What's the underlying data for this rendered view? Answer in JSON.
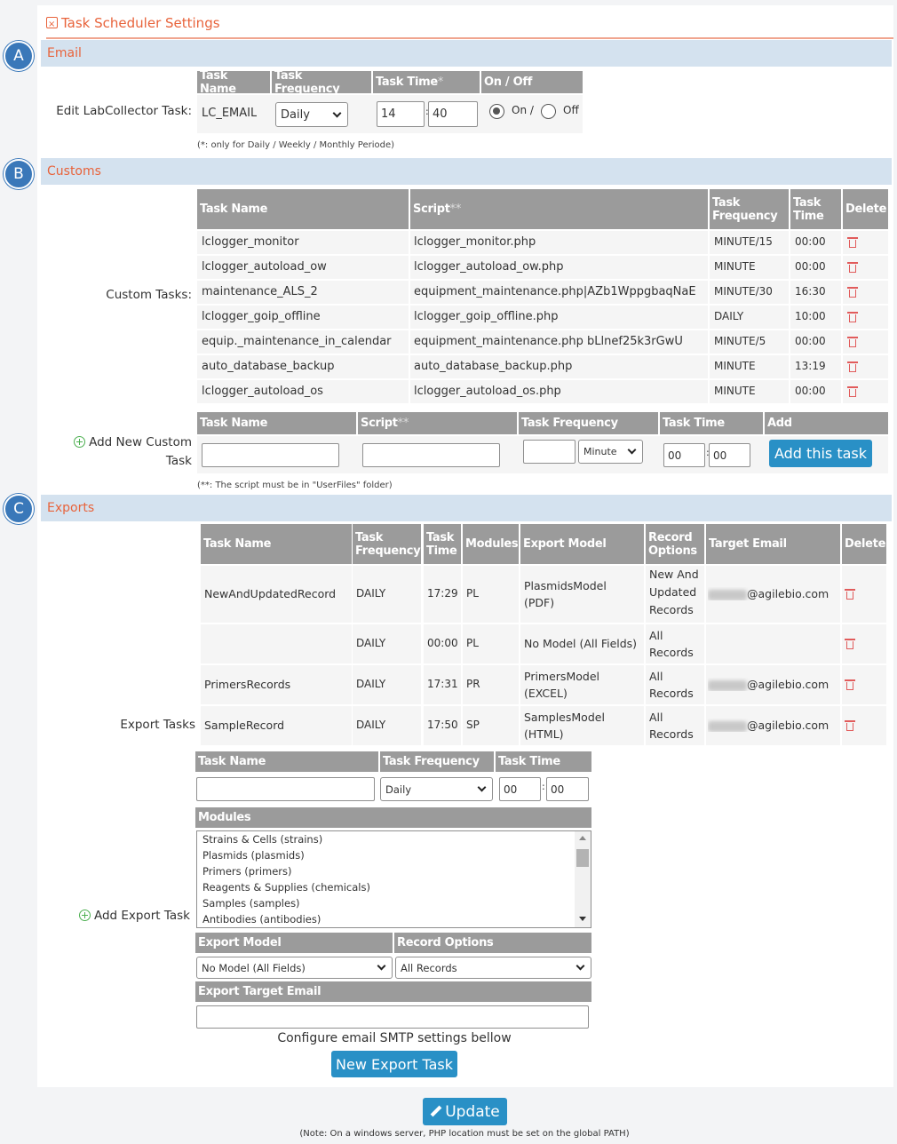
{
  "panel_title": "Task Scheduler Settings",
  "badges": {
    "a": "A",
    "b": "B",
    "c": "C"
  },
  "email": {
    "section": "Email",
    "row_label": "Edit LabCollector Task:",
    "headers": [
      "Task Name",
      "Task Frequency",
      "Task Time",
      "On / Off"
    ],
    "asterisk": "*",
    "task_name": "LC_EMAIL",
    "frequency": "Daily",
    "hour": "14",
    "minute": "40",
    "colon": ":",
    "on_label": "On /",
    "off_label": "Off",
    "note": "(*: only for Daily / Weekly / Monthly Periode)"
  },
  "customs": {
    "section": "Customs",
    "row_label": "Custom Tasks:",
    "headers": [
      "Task Name",
      "Script",
      "Task Frequency",
      "Task Time",
      "Delete"
    ],
    "asterisks": "**",
    "rows": [
      {
        "name": "lclogger_monitor",
        "script": "lclogger_monitor.php",
        "freq": "MINUTE/15",
        "time": "00:00"
      },
      {
        "name": "lclogger_autoload_ow",
        "script": "lclogger_autoload_ow.php",
        "freq": "MINUTE",
        "time": "00:00"
      },
      {
        "name": "maintenance_ALS_2",
        "script": "equipment_maintenance.php|AZb1WppgbaqNaE",
        "freq": "MINUTE/30",
        "time": "16:30"
      },
      {
        "name": "lclogger_goip_offline",
        "script": "lclogger_goip_offline.php",
        "freq": "DAILY",
        "time": "10:00"
      },
      {
        "name": "equip._maintenance_in_calendar",
        "script": "equipment_maintenance.php bLlnef25k3rGwU",
        "freq": "MINUTE/5",
        "time": "00:00"
      },
      {
        "name": "auto_database_backup",
        "script": "auto_database_backup.php",
        "freq": "MINUTE",
        "time": "13:19"
      },
      {
        "name": "lclogger_autoload_os",
        "script": "lclogger_autoload_os.php",
        "freq": "MINUTE",
        "time": "00:00"
      }
    ],
    "add_label_1": "Add New Custom",
    "add_label_2": "Task",
    "add_headers": [
      "Task Name",
      "Script",
      "Task Frequency",
      "Task Time",
      "Add"
    ],
    "add_freq_select": "Minute",
    "add_hour": "00",
    "add_minute": "00",
    "add_button": "Add this task",
    "note": "(**: The script must be in \"UserFiles\" folder)"
  },
  "exports": {
    "section": "Exports",
    "row_label": "Export Tasks",
    "headers": {
      "name": "Task Name",
      "freq1": "Task",
      "freq2": "Frequency",
      "time1": "Task",
      "time2": "Time",
      "modules": "Modules",
      "model": "Export Model",
      "rec1": "Record",
      "rec2": "Options",
      "email": "Target Email",
      "delete": "Delete"
    },
    "rows": [
      {
        "name": "NewAndUpdatedRecord",
        "freq": "DAILY",
        "time": "17:29",
        "module": "PL",
        "model1": "PlasmidsModel",
        "model2": "(PDF)",
        "rec1": "New And",
        "rec2": "Updated",
        "rec3": "Records",
        "email": "@agilebio.com"
      },
      {
        "name": "",
        "freq": "DAILY",
        "time": "00:00",
        "module": "PL",
        "model1": "No Model (All Fields)",
        "model2": "",
        "rec1": "All",
        "rec2": "Records",
        "rec3": "",
        "email": ""
      },
      {
        "name": "PrimersRecords",
        "freq": "DAILY",
        "time": "17:31",
        "module": "PR",
        "model1": "PrimersModel",
        "model2": "(EXCEL)",
        "rec1": "All",
        "rec2": "Records",
        "rec3": "",
        "email": "@agilebio.com"
      },
      {
        "name": "SampleRecord",
        "freq": "DAILY",
        "time": "17:50",
        "module": "SP",
        "model1": "SamplesModel",
        "model2": "(HTML)",
        "rec1": "All",
        "rec2": "Records",
        "rec3": "",
        "email": "@agilebio.com"
      }
    ],
    "add_label": "Add Export Task",
    "add_headers": {
      "name": "Task Name",
      "freq": "Task Frequency",
      "time": "Task Time",
      "modules": "Modules",
      "model": "Export Model",
      "rec": "Record Options",
      "email": "Export Target Email"
    },
    "freq_select": "Daily",
    "hour": "00",
    "minute": "00",
    "module_options": [
      "Strains & Cells (strains)",
      "Plasmids (plasmids)",
      "Primers (primers)",
      "Reagents & Supplies (chemicals)",
      "Samples (samples)",
      "Antibodies (antibodies)"
    ],
    "model_select": "No Model (All Fields)",
    "rec_select": "All Records",
    "smtp_note": "Configure email SMTP settings bellow",
    "new_button": "New Export Task"
  },
  "update_button": "Update",
  "footer_note": "(Note: On a windows server, PHP location must be set on the global PATH)"
}
